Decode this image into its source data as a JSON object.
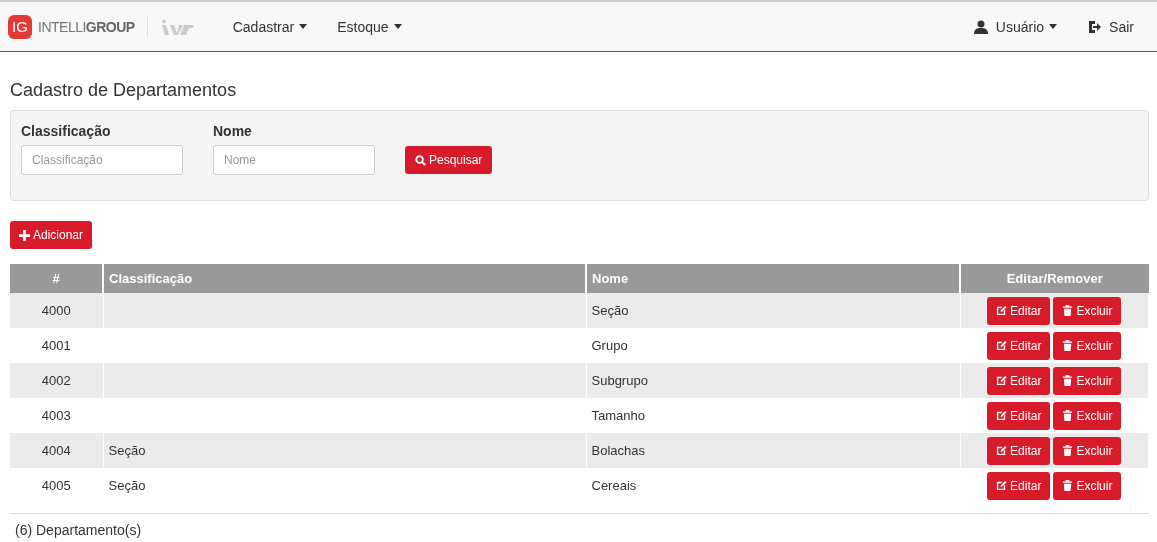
{
  "navbar": {
    "logo_badge": "IG",
    "logo_text": "INTELLI**GROUP**",
    "menus": [
      {
        "label": "Cadastrar",
        "dropdown": true
      },
      {
        "label": "Estoque",
        "dropdown": true
      }
    ],
    "right": [
      {
        "kind": "user",
        "label": "Usuário",
        "dropdown": true
      },
      {
        "kind": "logout",
        "label": "Sair",
        "dropdown": false
      }
    ]
  },
  "page_title": "Cadastro de Departamentos",
  "filters": [
    {
      "label": "Classificação",
      "placeholder": "Classificação"
    },
    {
      "label": "Nome",
      "placeholder": "Nome"
    }
  ],
  "search_button": "Pesquisar",
  "add_button": "Adicionar",
  "table": {
    "columns": [
      "#",
      "Classificação",
      "Nome",
      "Editar/Remover"
    ],
    "rows": [
      {
        "id": "4000",
        "classificacao": "",
        "nome": "Seção",
        "edit": "Editar",
        "remove": "Excluir"
      },
      {
        "id": "4001",
        "classificacao": "",
        "nome": "Grupo",
        "edit": "Editar",
        "remove": "Excluir"
      },
      {
        "id": "4002",
        "classificacao": "",
        "nome": "Subgrupo",
        "edit": "Editar",
        "remove": "Excluir"
      },
      {
        "id": "4003",
        "classificacao": "",
        "nome": "Tamanho",
        "edit": "Editar",
        "remove": "Excluir"
      },
      {
        "id": "4004",
        "classificacao": "Seção",
        "nome": "Bolachas",
        "edit": "Editar",
        "remove": "Excluir"
      },
      {
        "id": "4005",
        "classificacao": "Seção",
        "nome": "Cereais",
        "edit": "Editar",
        "remove": "Excluir"
      }
    ]
  },
  "footer_count": "(6) Departamento(s)"
}
